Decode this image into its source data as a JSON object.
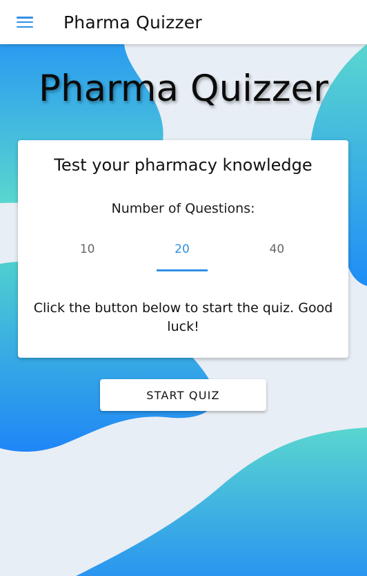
{
  "appbar": {
    "menu_icon": "hamburger-menu-icon",
    "title": "Pharma Quizzer"
  },
  "hero": {
    "title": "Pharma Quizzer"
  },
  "card": {
    "heading": "Test your pharmacy knowledge",
    "question_count_label": "Number of Questions:",
    "options": [
      {
        "label": "10",
        "selected": false
      },
      {
        "label": "20",
        "selected": true
      },
      {
        "label": "40",
        "selected": false
      }
    ],
    "instructions": "Click the button below to start the quiz. Good luck!"
  },
  "start_button": {
    "label": "START QUIZ"
  },
  "colors": {
    "accent": "#2f8fe6",
    "background": "#e8eef5",
    "blob_teal": "#5ad6cf",
    "blob_blue": "#1d8cf8"
  }
}
